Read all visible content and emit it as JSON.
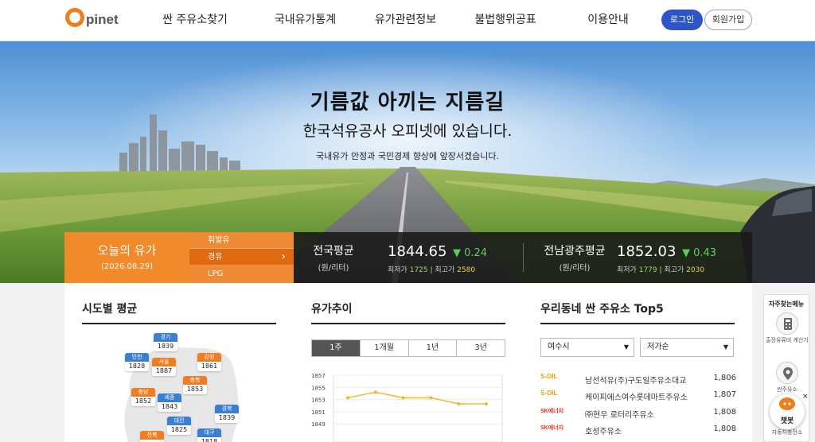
{
  "header": {
    "logo_letter": "O",
    "logo_text": "pinet",
    "nav": [
      "싼 주유소찾기",
      "국내유가통계",
      "유가관련정보",
      "불법행위공표",
      "이용안내"
    ],
    "login": "로그인",
    "join": "회원가입"
  },
  "hero": {
    "title": "기름값 아끼는 지름길",
    "subtitle": "한국석유공사 오피넷에 있습니다.",
    "desc": "국내유가 안정과 국민경제 향상에 앞장서겠습니다."
  },
  "today": {
    "title": "오늘의 유가",
    "date": "(2026.08.29)",
    "fuel_tabs": [
      "휘발유",
      "경유",
      "LPG"
    ],
    "active_fuel": "경유"
  },
  "price_bar": {
    "national": {
      "label": "전국평균",
      "unit": "(원/리터)",
      "value": "1844.65",
      "change": "▼ 0.24",
      "min_label": "최저가",
      "min": "1725",
      "max_label": "최고가",
      "max": "2580"
    },
    "regional": {
      "label": "전남광주평균",
      "unit": "(원/리터)",
      "value": "1852.03",
      "change": "▼ 0.43",
      "min_label": "최저가",
      "min": "1779",
      "max_label": "최고가",
      "max": "2030"
    },
    "divider": "|"
  },
  "regions_card": {
    "title": "시도별 평균",
    "regions": [
      {
        "name": "경기",
        "value": "1839",
        "color": "blue"
      },
      {
        "name": "인천",
        "value": "1828",
        "color": "blue"
      },
      {
        "name": "서울",
        "value": "1887",
        "color": "orange"
      },
      {
        "name": "강원",
        "value": "1861",
        "color": "orange"
      },
      {
        "name": "충북",
        "value": "1853",
        "color": "orange"
      },
      {
        "name": "충남",
        "value": "1852",
        "color": "orange"
      },
      {
        "name": "세종",
        "value": "1843",
        "color": "blue"
      },
      {
        "name": "경북",
        "value": "1839",
        "color": "blue"
      },
      {
        "name": "대전",
        "value": "1825",
        "color": "blue"
      },
      {
        "name": "전북",
        "value": "",
        "color": "orange"
      },
      {
        "name": "대구",
        "value": "1818",
        "color": "blue"
      }
    ]
  },
  "trend_card": {
    "title": "유가추이",
    "periods": [
      "1주",
      "1개월",
      "1년",
      "3년"
    ],
    "active_period": "1주"
  },
  "chart_data": {
    "type": "line",
    "title": "",
    "xlabel": "",
    "ylabel": "",
    "ylim": [
      1848,
      1857
    ],
    "yticks": [
      "1857",
      "1855",
      "1853",
      "1851",
      "1849"
    ],
    "series": [
      {
        "values": [
          1853.3,
          1854.2,
          1853.3,
          1853.3,
          1852.3,
          1852.3
        ]
      }
    ],
    "grid": true,
    "color": "#f5b52e"
  },
  "top5_card": {
    "title": "우리동네 싼 주유소 Top5",
    "region_select": "여수시",
    "sort_select": "저가순",
    "stations": [
      {
        "brand": "S-OIL",
        "name": "남선석유(주)구도일주유소대교",
        "price": "1,806"
      },
      {
        "brand": "S-OIL",
        "name": "케이피에스여수롯데마트주유소",
        "price": "1,807"
      },
      {
        "brand": "SK에너지",
        "name": "㈜현우 로터리주유소",
        "price": "1,808"
      },
      {
        "brand": "SK에너지",
        "name": "호성주유소",
        "price": "1,808"
      }
    ]
  },
  "side_menu": {
    "title": "자주찾는메뉴",
    "items": [
      "출장유류비 계산기",
      "싼주유소",
      "자동차충전소"
    ]
  },
  "chatbot": {
    "label": "챗봇",
    "close": "×"
  },
  "colors": {
    "brand": "#f07c1a",
    "login": "#2d55c8",
    "down": "#5ad05a",
    "line": "#f5b52e"
  },
  "icons": [
    "calculator-icon",
    "location-pin-icon",
    "chatbot-icon",
    "chevron-right-icon",
    "chevron-down-icon",
    "triangle-down-icon"
  ]
}
